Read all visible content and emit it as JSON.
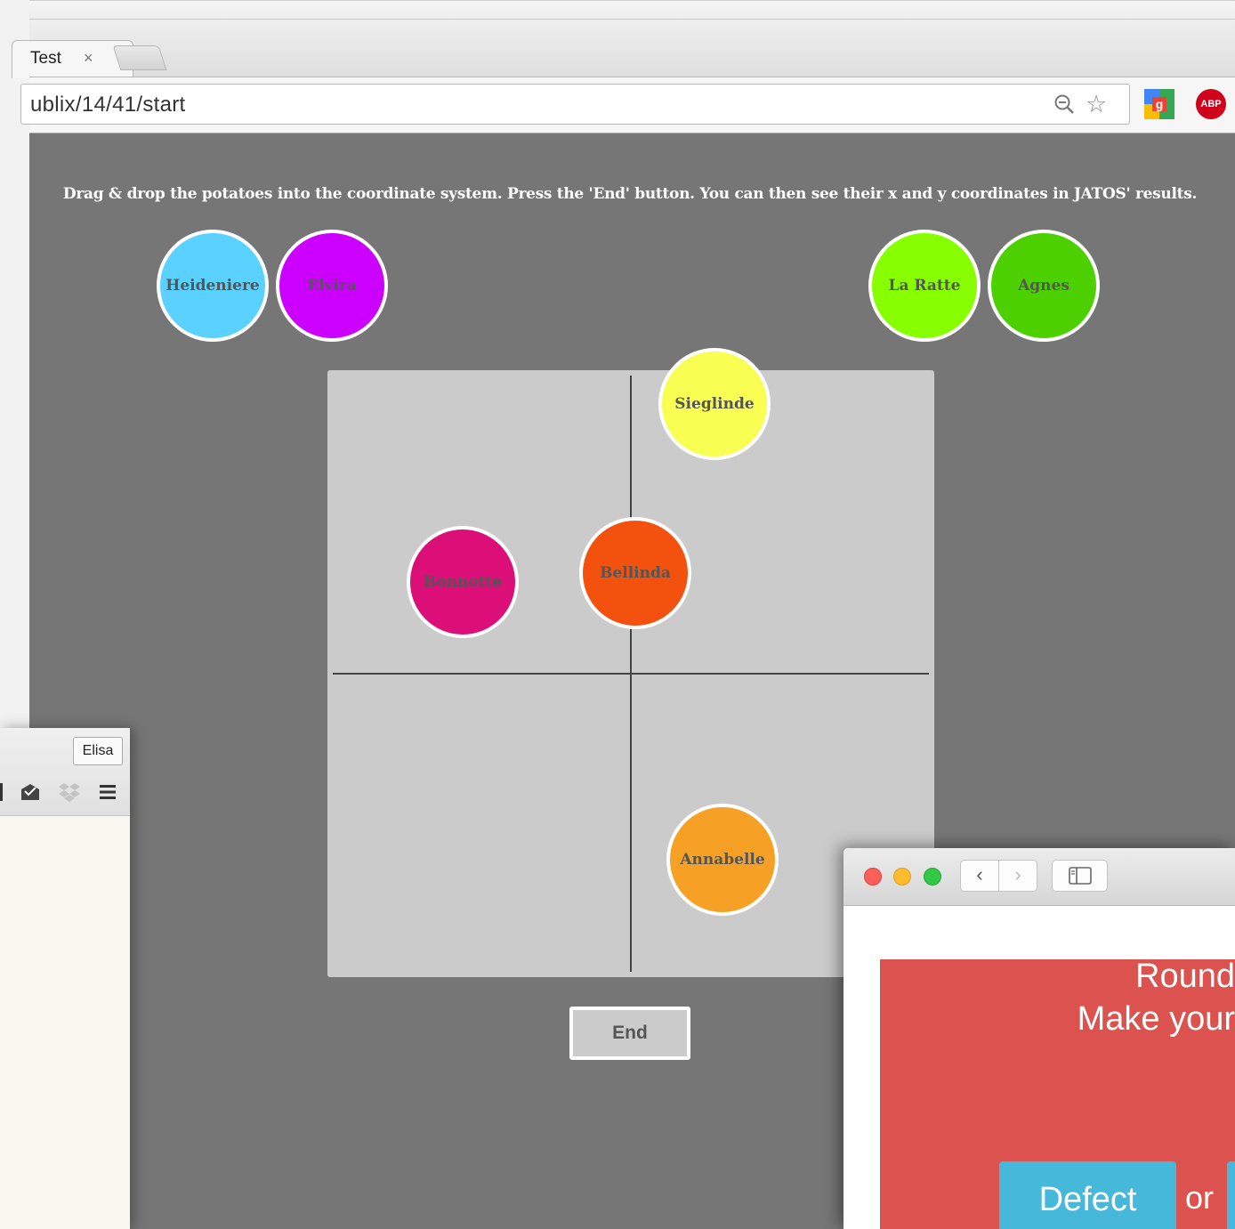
{
  "browser": {
    "tab_title": "Test",
    "tab_close": "×",
    "url": "ublix/14/41/start",
    "icons": [
      "zoom-icon",
      "star-icon",
      "google-icon",
      "adblock-plus-icon"
    ],
    "abp_label": "ABP",
    "star_glyph": "☆"
  },
  "page": {
    "instruction": "Drag & drop the potatoes into the coordinate system. Press the 'End' button. You can then see their x and y coordinates in JATOS' results.",
    "end_label": "End",
    "potatoes": [
      {
        "label": "Heideniere",
        "color": "#5ad1ff"
      },
      {
        "label": "Elvira",
        "color": "#cc00ff"
      },
      {
        "label": "La Ratte",
        "color": "#88ff00"
      },
      {
        "label": "Agnes",
        "color": "#4cd000"
      },
      {
        "label": "Sieglinde",
        "color": "#f8ff52"
      },
      {
        "label": "Bonnotte",
        "color": "#dc0e78"
      },
      {
        "label": "Bellinda",
        "color": "#f3510e"
      },
      {
        "label": "Annabelle",
        "color": "#f6a025"
      }
    ]
  },
  "mail_window": {
    "account_button": "Elisa"
  },
  "safari_window": {
    "back_glyph": "‹",
    "forward_glyph": "›",
    "round_text": "Round",
    "make_text": "Make your",
    "defect_label": "Defect",
    "or_text": "or",
    "panel_color": "#dc524e",
    "button_color": "#46b8da"
  }
}
